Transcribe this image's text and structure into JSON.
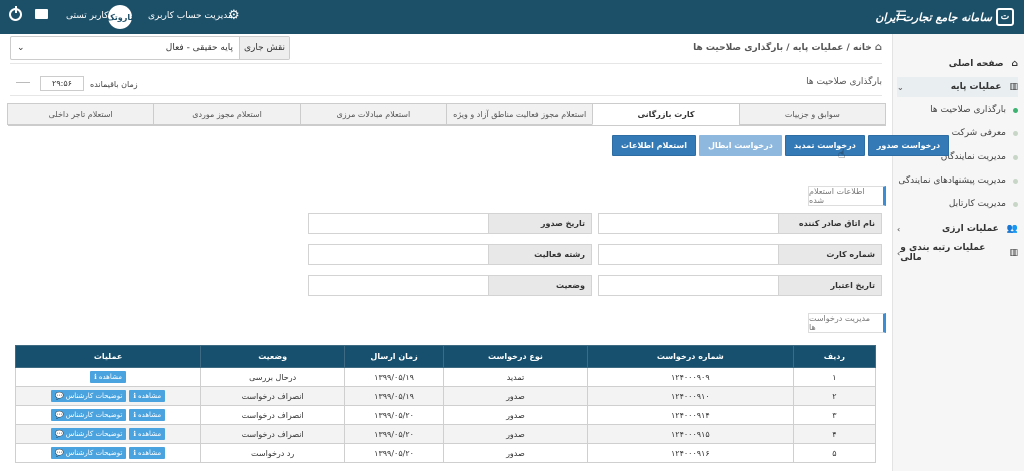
{
  "topbar": {
    "brand": "سامانه جامع تجارت ایران",
    "brand_mark": "ت",
    "account_mgmt": "مدیریت حساب کاربری",
    "avatar_text": "تاروتک",
    "user_name": "کاربر تستی"
  },
  "sidebar": {
    "items": [
      {
        "label": "صفحه اصلی"
      },
      {
        "label": "عملیات پایه"
      },
      {
        "label": "عملیات ارزی"
      },
      {
        "label": "عملیات رتبه بندی و مالی"
      }
    ],
    "subitems": [
      {
        "label": "بارگذاری صلاحیت ها",
        "active": true
      },
      {
        "label": "معرفی شرکت",
        "active": false
      },
      {
        "label": "مدیریت نمایندگان",
        "active": false
      },
      {
        "label": "مدیریت پیشنهادهای نمایندگی",
        "active": false
      },
      {
        "label": "مدیریت کارتابل",
        "active": false
      }
    ]
  },
  "breadcrumb": {
    "home": "خانه",
    "sep": "/",
    "section": "عملیات پایه",
    "page": "بارگذاری صلاحیت ها"
  },
  "role": {
    "label": "نقش جاری",
    "value": "پایه حقیقی - فعال"
  },
  "header": {
    "title": "بارگذاری صلاحیت ها",
    "remaining_label": "زمان باقیمانده",
    "timer": "۲۹:۵۶"
  },
  "tabs": [
    {
      "label": "سوابق و جزییات",
      "active": false
    },
    {
      "label": "کارت بازرگانی",
      "active": true
    },
    {
      "label": "استعلام مجوز فعالیت مناطق آزاد و ویژه",
      "active": false
    },
    {
      "label": "استعلام مبادلات مرزی",
      "active": false
    },
    {
      "label": "استعلام مجوز موردی",
      "active": false
    },
    {
      "label": "استعلام تاجر داخلی",
      "active": false
    }
  ],
  "actions": [
    {
      "label": "درخواست صدور",
      "disabled": false
    },
    {
      "label": "درخواست تمدید",
      "disabled": false
    },
    {
      "label": "درخواست ابطال",
      "disabled": true
    },
    {
      "label": "استعلام اطلاعات",
      "disabled": false
    }
  ],
  "inquiry": {
    "header": "اطلاعات استعلام شده",
    "fields": [
      {
        "label": "نام اتاق صادر کننده"
      },
      {
        "label": "تاریخ صدور"
      },
      {
        "label": "شماره کارت"
      },
      {
        "label": "رشته فعالیت"
      },
      {
        "label": "تاریخ اعتبار"
      },
      {
        "label": "وضعیت"
      }
    ]
  },
  "requests": {
    "header": "مدیریت درخواست ها",
    "columns": [
      "ردیف",
      "شماره درخواست",
      "نوع درخواست",
      "زمان ارسال",
      "وضعیت",
      "عملیات"
    ],
    "view_label": "مشاهده",
    "notes_label": "توضیحات کارشناس",
    "rows": [
      {
        "idx": "۱",
        "num": "۱۲۴۰۰۰۹۰۹",
        "type": "تمدید",
        "date": "۱۳۹۹/۰۵/۱۹",
        "status": "درحال بررسی",
        "notes": false
      },
      {
        "idx": "۲",
        "num": "۱۲۴۰۰۰۹۱۰",
        "type": "صدور",
        "date": "۱۳۹۹/۰۵/۱۹",
        "status": "انصراف درخواست",
        "notes": true
      },
      {
        "idx": "۳",
        "num": "۱۲۴۰۰۰۹۱۴",
        "type": "صدور",
        "date": "۱۳۹۹/۰۵/۲۰",
        "status": "انصراف درخواست",
        "notes": true
      },
      {
        "idx": "۴",
        "num": "۱۲۴۰۰۰۹۱۵",
        "type": "صدور",
        "date": "۱۳۹۹/۰۵/۲۰",
        "status": "انصراف درخواست",
        "notes": true
      },
      {
        "idx": "۵",
        "num": "۱۲۴۰۰۰۹۱۶",
        "type": "صدور",
        "date": "۱۳۹۹/۰۵/۲۰",
        "status": "رد درخواست",
        "notes": true
      }
    ]
  }
}
